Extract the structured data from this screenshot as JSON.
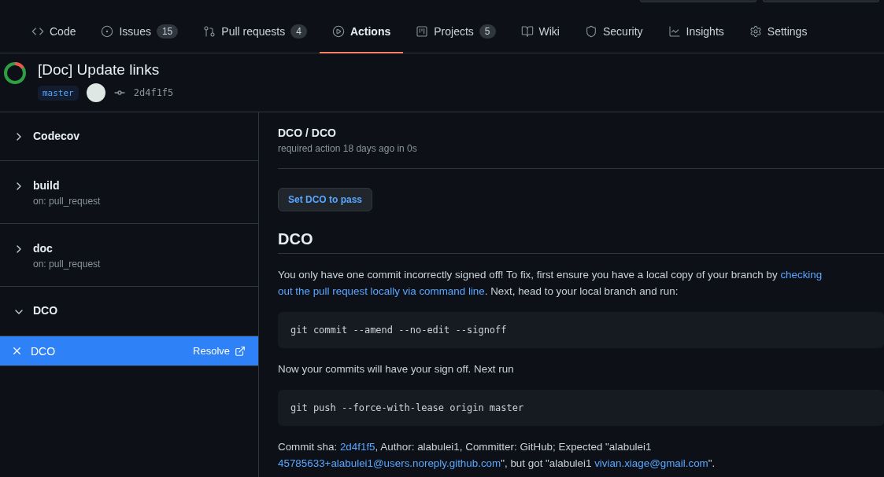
{
  "tabs": [
    {
      "label": "Code",
      "selected": false
    },
    {
      "label": "Issues",
      "count": "15",
      "selected": false
    },
    {
      "label": "Pull requests",
      "count": "4",
      "selected": false
    },
    {
      "label": "Actions",
      "selected": true
    },
    {
      "label": "Projects",
      "count": "5",
      "selected": false
    },
    {
      "label": "Wiki",
      "selected": false
    },
    {
      "label": "Security",
      "selected": false
    },
    {
      "label": "Insights",
      "selected": false
    },
    {
      "label": "Settings",
      "selected": false
    }
  ],
  "run": {
    "title": "[Doc] Update links",
    "branch": "master",
    "commit": "2d4f1f5"
  },
  "jobs": [
    {
      "name": "Codecov",
      "expanded": false
    },
    {
      "name": "build",
      "trigger": "on: pull_request",
      "expanded": false
    },
    {
      "name": "doc",
      "trigger": "on: pull_request",
      "expanded": false
    },
    {
      "name": "DCO",
      "expanded": true,
      "children": [
        {
          "name": "DCO",
          "selected": true,
          "action": "Resolve"
        }
      ]
    }
  ],
  "detail": {
    "title": "DCO / DCO",
    "subtitle": "required action 18 days ago in 0s",
    "button": "Set DCO to pass",
    "blocks": [
      {
        "kind": "heading",
        "text": "DCO"
      },
      {
        "kind": "paragraph",
        "lines": [
          [
            {
              "text": "You only have one commit incorrectly signed off! To fix, first ensure you have a local copy of your branch by ",
              "link": false
            },
            {
              "text": "checking",
              "link": true
            }
          ],
          [
            {
              "text": "out the pull request locally via command line",
              "link": true
            },
            {
              "text": ". Next, head to your local branch and run:",
              "link": false
            }
          ]
        ]
      },
      {
        "kind": "code",
        "text": "git commit --amend --no-edit --signoff"
      },
      {
        "kind": "paragraph",
        "lines": [
          [
            {
              "text": "Now your commits will have your sign off. Next run",
              "link": false
            }
          ]
        ]
      },
      {
        "kind": "code",
        "text": "git push --force-with-lease origin master"
      },
      {
        "kind": "paragraph",
        "lines": [
          [
            {
              "text": "Commit sha: ",
              "link": false
            },
            {
              "text": "2d4f1f5",
              "link": true
            },
            {
              "text": ", Author: alabulei1, Committer: GitHub; Expected \"alabulei1",
              "link": false
            }
          ],
          [
            {
              "text": "45785633+alabulei1@users.noreply.github.com",
              "link": true
            },
            {
              "text": "\", but got \"alabulei1 ",
              "link": false
            },
            {
              "text": "vivian.xiage@gmail.com",
              "link": true
            },
            {
              "text": "\".",
              "link": false
            }
          ]
        ]
      }
    ]
  }
}
